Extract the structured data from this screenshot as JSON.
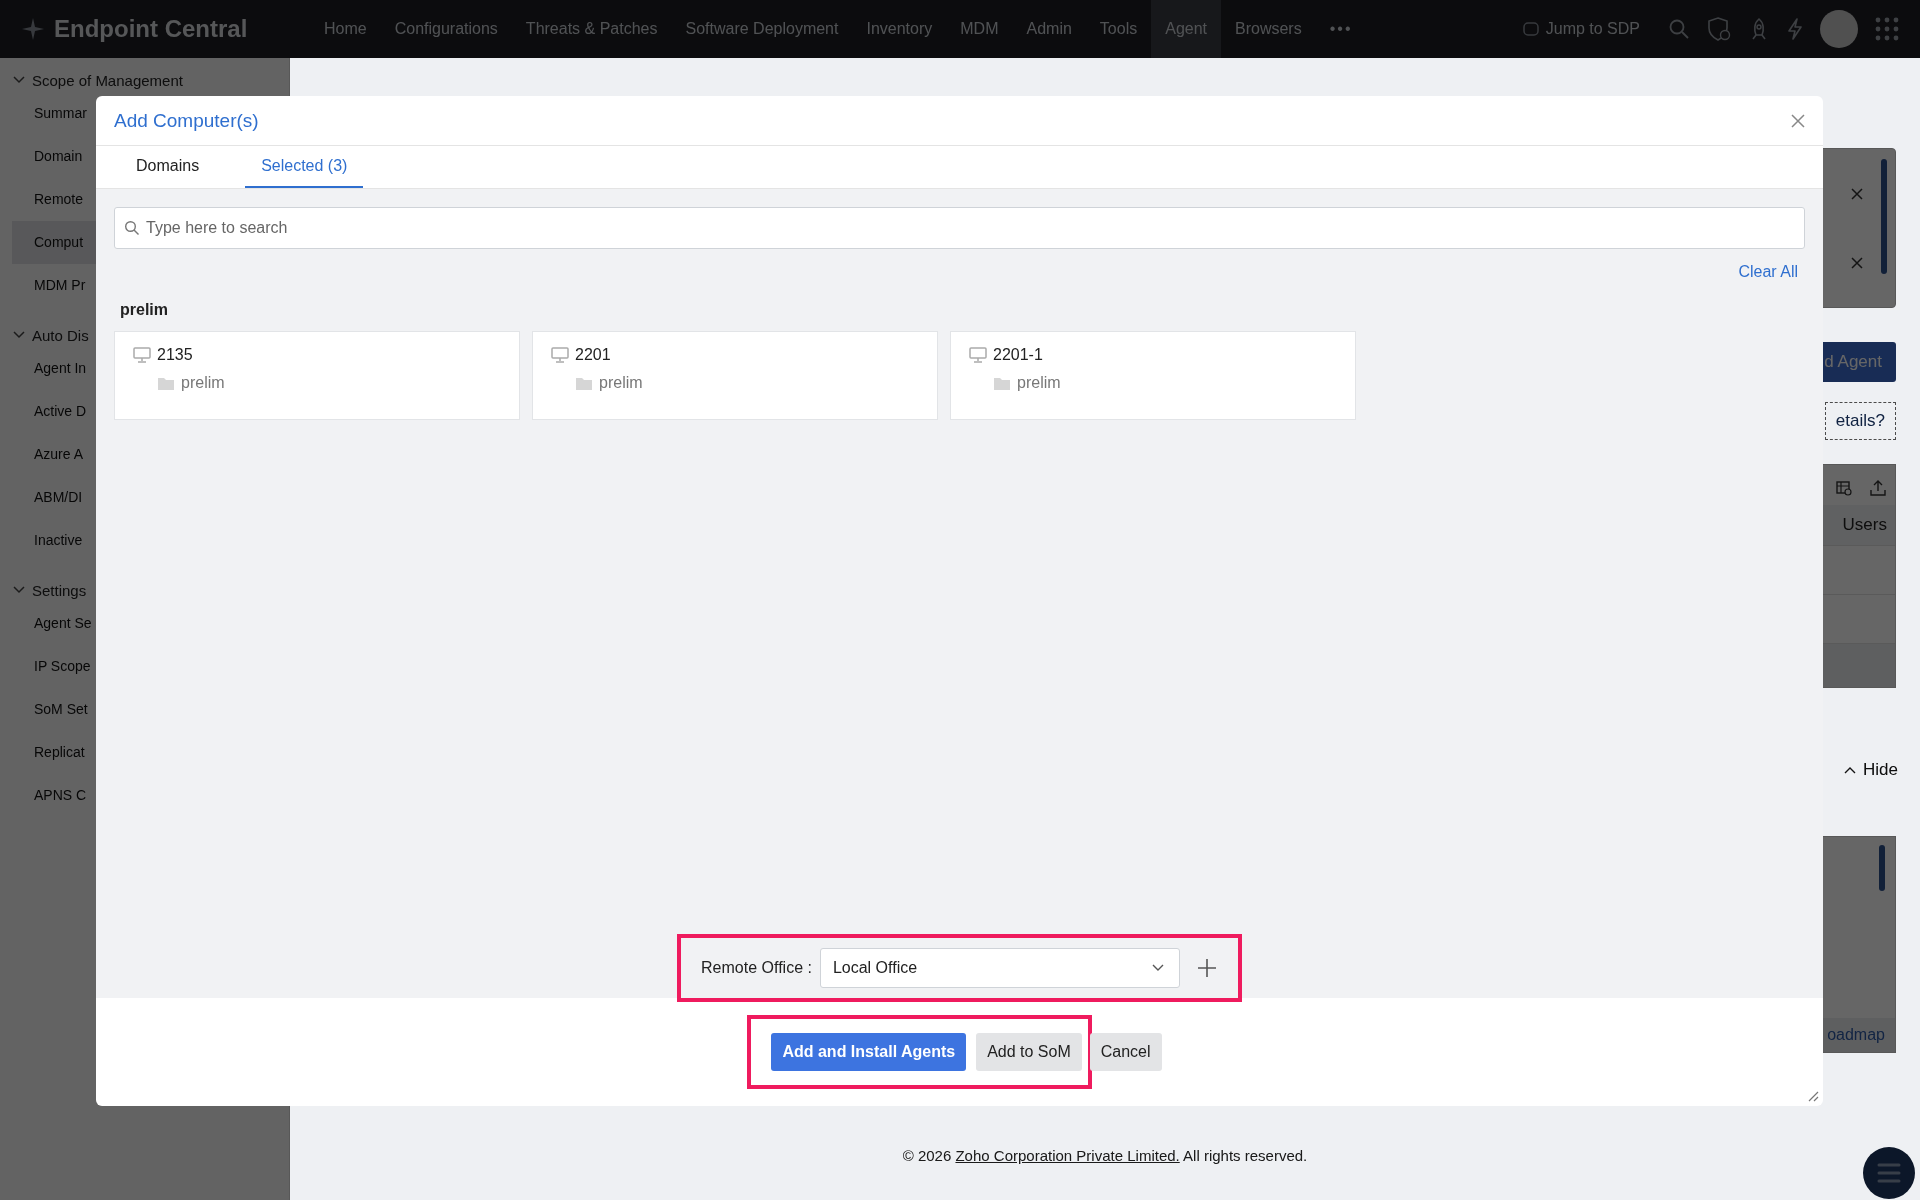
{
  "app": {
    "name": "Endpoint Central"
  },
  "nav": [
    {
      "label": "Home",
      "selected": false
    },
    {
      "label": "Configurations",
      "selected": false
    },
    {
      "label": "Threats & Patches",
      "selected": false
    },
    {
      "label": "Software Deployment",
      "selected": false
    },
    {
      "label": "Inventory",
      "selected": false
    },
    {
      "label": "MDM",
      "selected": false
    },
    {
      "label": "Admin",
      "selected": false
    },
    {
      "label": "Tools",
      "selected": false
    },
    {
      "label": "Agent",
      "selected": true
    },
    {
      "label": "Browsers",
      "selected": false
    }
  ],
  "nav_more": "•••",
  "jump": "Jump to SDP",
  "sidebar": [
    {
      "label": "Scope of Management",
      "expanded": true,
      "children": [
        {
          "label": "Summar",
          "selected": false
        },
        {
          "label": "Domain",
          "selected": false
        },
        {
          "label": "Remote",
          "selected": false
        },
        {
          "label": "Comput",
          "selected": true
        },
        {
          "label": "MDM Pr",
          "selected": false
        }
      ]
    },
    {
      "label": "Auto Dis",
      "expanded": true,
      "children": [
        {
          "label": "Agent In",
          "selected": false
        },
        {
          "label": "Active D",
          "selected": false
        },
        {
          "label": "Azure A",
          "selected": false
        },
        {
          "label": "ABM/DI",
          "selected": false
        },
        {
          "label": "Inactive",
          "selected": false
        }
      ]
    },
    {
      "label": "Settings",
      "expanded": true,
      "children": [
        {
          "label": "Agent Se",
          "selected": false
        },
        {
          "label": "IP Scope",
          "selected": false
        },
        {
          "label": "SoM Set",
          "selected": false
        },
        {
          "label": "Replicat",
          "selected": false
        },
        {
          "label": "APNS C",
          "selected": false
        }
      ]
    }
  ],
  "background": {
    "add_agent": "d Agent",
    "details_link": "etails?",
    "column": "Users",
    "hide": "Hide",
    "roadmap": "oadmap"
  },
  "dialog": {
    "title": "Add Computer(s)",
    "tabs": [
      {
        "label": "Domains",
        "selected": false
      },
      {
        "label": "Selected (3)",
        "selected": true
      }
    ],
    "search": {
      "placeholder": "Type here to search"
    },
    "clear_all": "Clear All",
    "groups": [
      {
        "name": "prelim",
        "computers": [
          {
            "name": "2135",
            "domain": "prelim"
          },
          {
            "name": "2201",
            "domain": "prelim"
          },
          {
            "name": "2201-1",
            "domain": "prelim"
          }
        ]
      }
    ],
    "remote_office": {
      "label": "Remote Office :",
      "value": "Local Office",
      "highlighted": true
    },
    "action_groups": [
      {
        "highlighted": true,
        "buttons": [
          {
            "label": "Add and Install Agents",
            "kind": "primary"
          },
          {
            "label": "Add to SoM",
            "kind": "secondary"
          }
        ]
      },
      {
        "highlighted": false,
        "buttons": [
          {
            "label": "Cancel",
            "kind": "secondary"
          }
        ]
      }
    ]
  },
  "footer": {
    "copyright": "© 2026",
    "link": "Zoho Corporation Private Limited.",
    "rights": "All rights reserved."
  }
}
